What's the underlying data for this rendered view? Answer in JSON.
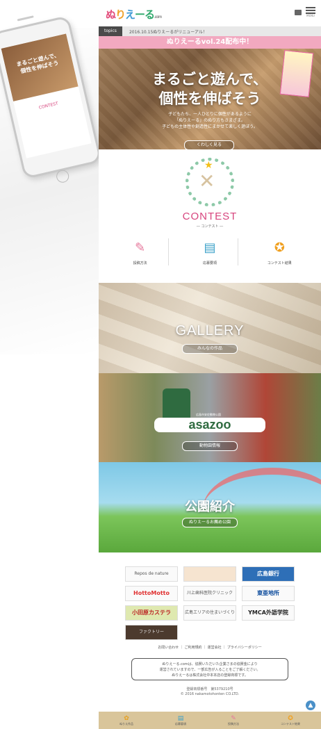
{
  "header": {
    "logo_parts": [
      "ぬ",
      "り",
      "え",
      "ーる"
    ],
    "logo_suffix": ".com",
    "menu_label": "MENU"
  },
  "topics": {
    "label": "topics",
    "text": "2016.10.15ぬりえーるがリニューアル！"
  },
  "hero": {
    "ribbon": "ぬりえーるvol.24配布中！",
    "title_line1": "まるごと遊んで、",
    "title_line2": "個性を伸ばそう",
    "desc_line1": "子どもたち、一人ひとりに個性があるように",
    "desc_line2": "「ぬりえーる」のぬり方もさまざま。",
    "desc_line3": "子どもの主体性や創造性にまかせて楽しく遊ぼう。",
    "button": "くわしく見る"
  },
  "phone": {
    "hero_line1": "まるごと遊んで、",
    "hero_line2": "個性を伸ばそう",
    "contest": "CONTEST"
  },
  "contest": {
    "title": "CONTEST",
    "subtitle": "― コンテスト ―",
    "items": [
      {
        "label": "投稿方法",
        "icon": "pencil-icon"
      },
      {
        "label": "応募要項",
        "icon": "document-icon"
      },
      {
        "label": "コンテスト結果",
        "icon": "medal-icon"
      }
    ]
  },
  "gallery": {
    "title": "GALLERY",
    "button": "みんなの作品"
  },
  "zoo": {
    "logo_text": "asazoo",
    "logo_caption": "広島市安佐動物公園",
    "button": "動物園情報"
  },
  "park": {
    "title": "公園紹介",
    "button": "ぬりえーるお薦め公園"
  },
  "sponsors": [
    {
      "label": "Repos de nature",
      "style": ""
    },
    {
      "label": "",
      "style": ""
    },
    {
      "label": "広島銀行",
      "style": "hb"
    },
    {
      "label": "HottoMotto",
      "style": "hm"
    },
    {
      "label": "川上歯科医院クリニック",
      "style": ""
    },
    {
      "label": "東亜地所",
      "style": "tt"
    },
    {
      "label": "小田原カステラ",
      "style": "kt"
    },
    {
      "label": "広島エリアの住まいづくり",
      "style": ""
    },
    {
      "label": "YMCA外語学院",
      "style": "ymca"
    },
    {
      "label": "ファクトリー",
      "style": "dk"
    }
  ],
  "footer": {
    "links": "お問い合わせ ｜ ご利用規約 ｜ 運営会社 ｜ プライバシーポリシー",
    "box_line1": "ぬりえーる.comは、協賛いただいた企業さまの協賛金により",
    "box_line2": "運営されていますので、一部広告が入ることをご了解ください。",
    "box_line3": "ぬりえーるは株式会社中本本店の登録商標です。",
    "copy_line1": "登録商標番号　第5379210号",
    "copy_line2": "© 2016 nakamotohonten CO.LTD."
  },
  "bottom_nav": [
    {
      "label": "ぬりえ作品",
      "icon": "flower-icon"
    },
    {
      "label": "応募要項",
      "icon": "document-icon"
    },
    {
      "label": "投稿方法",
      "icon": "pencil-icon"
    },
    {
      "label": "コンテスト結果",
      "icon": "medal-icon"
    }
  ],
  "colors": {
    "accent_pink": "#d7457e",
    "ribbon_pink": "#f2a9c0",
    "nav_bg": "#d9c59a"
  }
}
